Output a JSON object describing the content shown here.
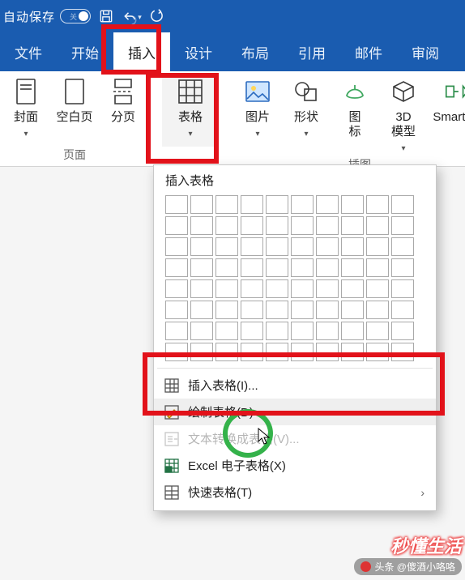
{
  "topbar": {
    "autosave_label": "自动保存",
    "toggle_state": "关"
  },
  "tabs": [
    {
      "id": "file",
      "label": "文件"
    },
    {
      "id": "home",
      "label": "开始"
    },
    {
      "id": "insert",
      "label": "插入",
      "active": true
    },
    {
      "id": "design",
      "label": "设计"
    },
    {
      "id": "layout",
      "label": "布局"
    },
    {
      "id": "ref",
      "label": "引用"
    },
    {
      "id": "mail",
      "label": "邮件"
    },
    {
      "id": "review",
      "label": "审阅"
    }
  ],
  "ribbon": {
    "groups": {
      "pages": {
        "label": "页面",
        "cover": "封面",
        "blank": "空白页",
        "break": "分页"
      },
      "tables": {
        "table": "表格"
      },
      "illustrations": {
        "label": "插图",
        "picture": "图片",
        "shapes": "形状",
        "icons": "图\n标",
        "model3d": "3D\n模型",
        "smartart": "SmartArt"
      }
    }
  },
  "dropdown": {
    "title": "插入表格",
    "grid_cols": 10,
    "grid_rows": 8,
    "items": [
      {
        "id": "insert-table",
        "label": "插入表格(I)...",
        "enabled": true,
        "icon": "table-icon"
      },
      {
        "id": "draw-table",
        "label": "绘制表格(D)",
        "enabled": true,
        "icon": "draw-table-icon",
        "hover": true
      },
      {
        "id": "text-to",
        "label": "文本转换成表格(V)...",
        "enabled": false,
        "icon": "convert-icon"
      },
      {
        "id": "excel",
        "label": "Excel 电子表格(X)",
        "enabled": true,
        "icon": "excel-icon"
      },
      {
        "id": "quick",
        "label": "快速表格(T)",
        "enabled": true,
        "icon": "quick-table-icon",
        "submenu": true
      }
    ]
  },
  "watermark": {
    "line1": "秒懂生活",
    "line2": "头条 @傻酒小咯咯"
  }
}
